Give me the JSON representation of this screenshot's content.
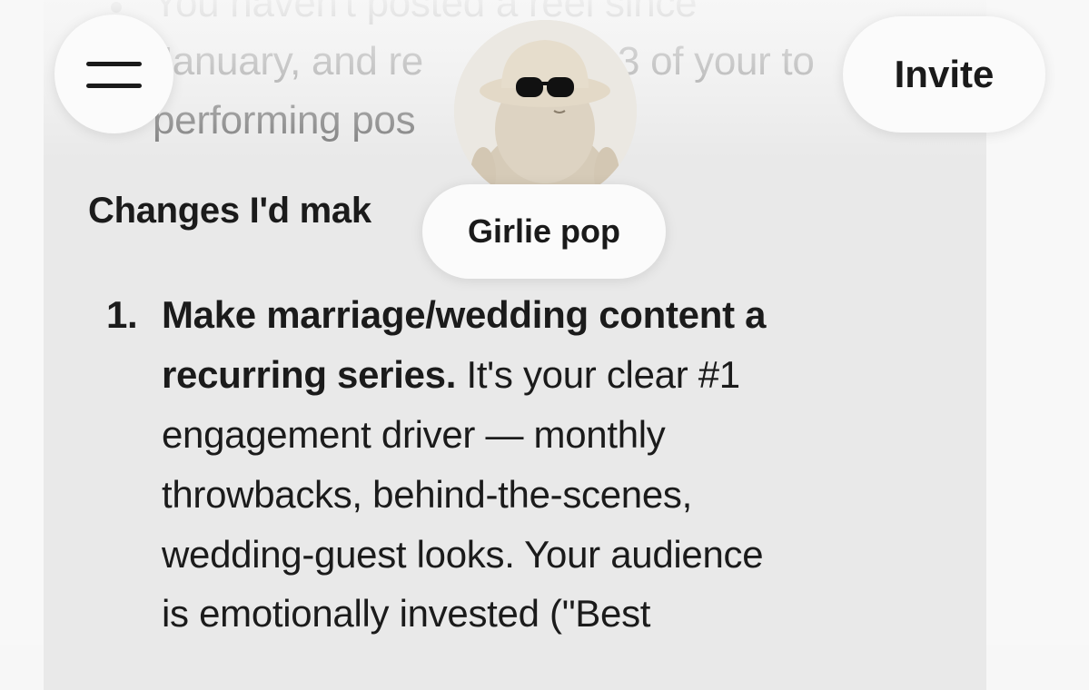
{
  "nav": {
    "menu_icon": "hamburger-menu-icon",
    "invite_label": "Invite"
  },
  "chat": {
    "name": "Girlie pop",
    "avatar": "fluffy-character-bucket-hat-sunglasses"
  },
  "message": {
    "bullet_lines": [
      "You haven't posted a reel since",
      "January, and re",
      "3 of your to",
      "performing pos"
    ],
    "section_heading": "Changes I'd mak",
    "list_item_number": "1.",
    "list_item_bold_1": "Make marriage/wedding content a",
    "list_item_bold_2": "recurring series.",
    "list_item_text_2": " It's your clear #1",
    "list_item_lines": [
      "engagement driver — monthly",
      "throwbacks, behind-the-scenes,",
      "wedding-guest looks. Your audience",
      "is emotionally invested (\"Best"
    ]
  }
}
